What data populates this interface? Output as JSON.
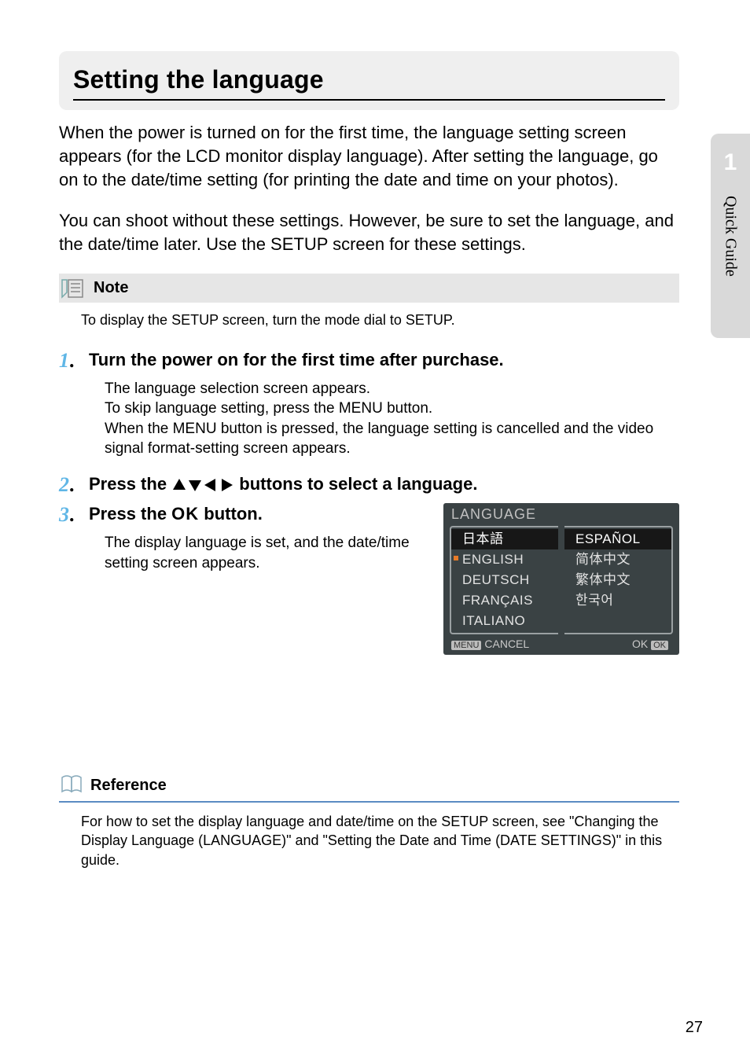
{
  "sidebar": {
    "chapter_num": "1",
    "chapter_label": "Quick Guide"
  },
  "heading": "Setting the language",
  "intro_p1": "When the power is turned on for the first time, the language setting screen appears (for the LCD monitor display language). After setting the language, go on to the date/time setting (for printing the date and time on your photos).",
  "intro_p2": "You can shoot without these settings. However, be sure to set the language, and the date/time later. Use the SETUP screen for these settings.",
  "note": {
    "label": "Note",
    "text": "To display the SETUP screen, turn the mode dial to SETUP."
  },
  "steps": [
    {
      "num": "1",
      "title": "Turn the power on for the first time after purchase.",
      "body": "The language selection screen appears.\nTo skip language setting, press the MENU button.\nWhen the MENU button is pressed, the language setting is cancelled and the video signal format-setting screen appears."
    },
    {
      "num": "2",
      "title_pre": "Press the ",
      "title_post": " buttons to select a language."
    },
    {
      "num": "3",
      "title_pre": "Press the ",
      "title_mid": "O",
      "title_post": " button.",
      "body": "The display language is set, and the date/time setting screen appears."
    }
  ],
  "lcd": {
    "title": "LANGUAGE",
    "left": [
      "日本語",
      "ENGLISH",
      "DEUTSCH",
      "FRANÇAIS",
      "ITALIANO"
    ],
    "right": [
      "ESPAÑOL",
      "简体中文",
      "繁体中文",
      "한국어",
      ""
    ],
    "selected_index": 1,
    "footer_left_key": "MENU",
    "footer_left": "CANCEL",
    "footer_right": "OK",
    "footer_right_key": "OK"
  },
  "reference": {
    "label": "Reference",
    "text": "For how to set the display language and date/time on the SETUP screen, see \"Changing the Display Language (LANGUAGE)\" and \"Setting the Date and Time (DATE SETTINGS)\" in this guide."
  },
  "page_number": "27"
}
